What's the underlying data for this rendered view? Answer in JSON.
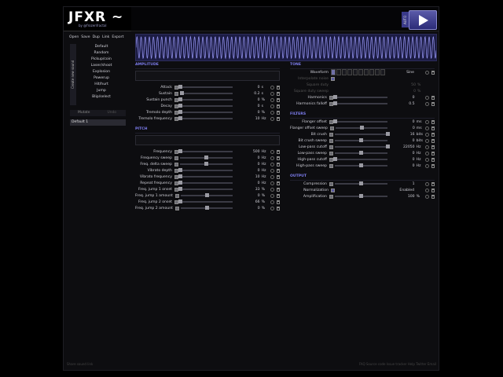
{
  "app": {
    "logo": "JFXR ~",
    "byline": "by @frozenfractal",
    "auto_label": "AUTO",
    "play_icon": "play-icon"
  },
  "toolbar": [
    "Open",
    "Save",
    "Dup",
    "Link",
    "Export"
  ],
  "sidebar": {
    "category_label": "Create new sound",
    "presets": [
      "Default",
      "Random",
      "Pickup/coin",
      "Laser/shoot",
      "Explosion",
      "Powerup",
      "Hit/hurt",
      "Jump",
      "Blip/select"
    ],
    "mutate": "Mutate",
    "undo": "Undo",
    "history_item": "Default 1"
  },
  "amplitude": {
    "title": "AMPLITUDE",
    "rows": [
      {
        "label": "Attack",
        "value": "0",
        "unit": "s",
        "pos": 0
      },
      {
        "label": "Sustain",
        "value": "0.2",
        "unit": "s",
        "pos": 0.03
      },
      {
        "label": "Sustain punch",
        "value": "0",
        "unit": "%",
        "pos": 0
      },
      {
        "label": "Decay",
        "value": "0",
        "unit": "s",
        "pos": 0
      },
      {
        "label": "Tremolo depth",
        "value": "0",
        "unit": "%",
        "pos": 0
      },
      {
        "label": "Tremolo frequency",
        "value": "10",
        "unit": "Hz",
        "pos": 0
      }
    ]
  },
  "pitch": {
    "title": "PITCH",
    "rows": [
      {
        "label": "Frequency",
        "value": "500",
        "unit": "Hz",
        "pos": 0
      },
      {
        "label": "Frequency sweep",
        "value": "0",
        "unit": "Hz",
        "pos": 0.5
      },
      {
        "label": "Freq. delta sweep",
        "value": "0",
        "unit": "Hz",
        "pos": 0.5
      },
      {
        "label": "Vibrato depth",
        "value": "0",
        "unit": "Hz",
        "pos": 0
      },
      {
        "label": "Vibrato frequency",
        "value": "10",
        "unit": "Hz",
        "pos": 0
      },
      {
        "label": "Repeat frequency",
        "value": "0",
        "unit": "Hz",
        "pos": 0
      },
      {
        "label": "Freq. jump 1 onset",
        "value": "33",
        "unit": "%",
        "pos": 0
      },
      {
        "label": "Freq. jump 1 amount",
        "value": "0",
        "unit": "%",
        "pos": 0.5
      },
      {
        "label": "Freq. jump 2 onset",
        "value": "66",
        "unit": "%",
        "pos": 0
      },
      {
        "label": "Freq. jump 2 amount",
        "value": "0",
        "unit": "%",
        "pos": 0.5
      }
    ]
  },
  "tone": {
    "title": "TONE",
    "waveform_label": "Waveform",
    "waveform_value": "Sine",
    "interpolate_label": "Interpolate noise",
    "square_duty_label": "Square duty",
    "square_duty_value": "50",
    "square_duty_unit": "%",
    "square_duty_sweep_label": "Square duty sweep",
    "square_duty_sweep_value": "0",
    "square_duty_sweep_unit": "%",
    "rows": [
      {
        "label": "Harmonics",
        "value": "0",
        "unit": "",
        "pos": 0
      },
      {
        "label": "Harmonics falloff",
        "value": "0.5",
        "unit": "",
        "pos": 0
      }
    ]
  },
  "filters": {
    "title": "FILTERS",
    "rows": [
      {
        "label": "Flanger offset",
        "value": "0",
        "unit": "ms",
        "pos": 0
      },
      {
        "label": "Flanger offset sweep",
        "value": "0",
        "unit": "ms",
        "pos": 0.5
      },
      {
        "label": "Bit crush",
        "value": "16",
        "unit": "bits",
        "pos": 1
      },
      {
        "label": "Bit crush sweep",
        "value": "0",
        "unit": "bits",
        "pos": 0.5
      },
      {
        "label": "Low-pass cutoff",
        "value": "22050",
        "unit": "Hz",
        "pos": 1
      },
      {
        "label": "Low-pass sweep",
        "value": "0",
        "unit": "Hz",
        "pos": 0.5
      },
      {
        "label": "High-pass cutoff",
        "value": "0",
        "unit": "Hz",
        "pos": 0
      },
      {
        "label": "High-pass sweep",
        "value": "0",
        "unit": "Hz",
        "pos": 0.5
      }
    ]
  },
  "output": {
    "title": "OUTPUT",
    "compression_label": "Compression",
    "compression_value": "1",
    "normalization_label": "Normalization",
    "normalization_value": "Enabled",
    "amplification_label": "Amplification",
    "amplification_value": "100",
    "amplification_unit": "%"
  },
  "footer": {
    "left": "Share sound link",
    "right": "FAQ  Source code  Issue tracker  Help  Twitter  Email"
  }
}
